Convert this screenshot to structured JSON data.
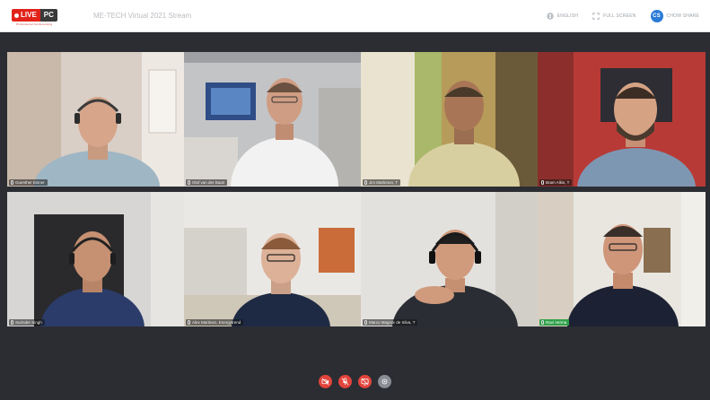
{
  "app": {
    "logo_live": "LIVE",
    "logo_pc": "PC",
    "logo_tagline": "Professional Conferencing",
    "event_title": "ME-TECH Virtual 2021 Stream"
  },
  "header": {
    "language_label": "ENGLISH",
    "fullscreen_label": "FULL SCREEN",
    "user_initials": "CS",
    "user_name": "CHOW SHARE"
  },
  "participants": [
    {
      "name": "Guenther Eisner",
      "active": false
    },
    {
      "name": "Olof van der Baan",
      "active": false
    },
    {
      "name": "Jim Marketon, T",
      "active": false
    },
    {
      "name": "Bram Alkis, T",
      "active": false
    },
    {
      "name": "Surinder Singh",
      "active": false
    },
    {
      "name": "Alex Martinez, Energytrend",
      "active": false
    },
    {
      "name": "Marco Magnor de Silva, T",
      "active": false
    },
    {
      "name": "Ravi Verma",
      "active": true
    }
  ],
  "controls": [
    {
      "icon": "camera-off-icon",
      "color": "#e2443b"
    },
    {
      "icon": "mic-off-icon",
      "color": "#e2443b"
    },
    {
      "icon": "screen-share-off-icon",
      "color": "#e2443b"
    },
    {
      "icon": "settings-icon",
      "color": "#8a8d94"
    }
  ],
  "colors": {
    "brand_red": "#e2231a",
    "active_speaker": "#3cc35a",
    "stage_bg": "#2b2d33",
    "avatar_blue": "#2a7bd8"
  }
}
